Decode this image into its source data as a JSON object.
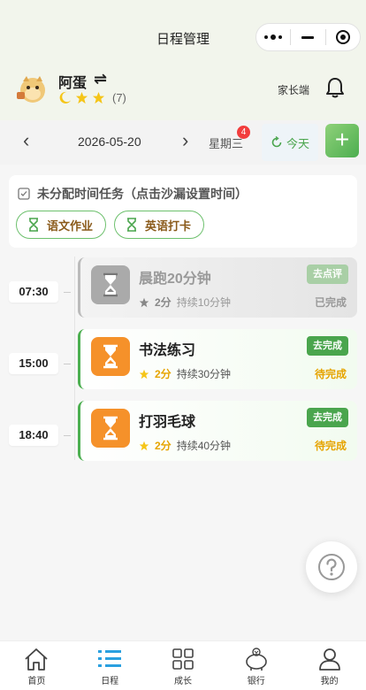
{
  "nav": {
    "title": "日程管理"
  },
  "profile": {
    "name": "阿蛋",
    "switch_icon": "⇌",
    "star_count": "(7)",
    "parent_link": "家长端"
  },
  "datebar": {
    "date": "2026-05-20",
    "weekday": "星期三",
    "badge": "4",
    "today": "今天",
    "add": "+"
  },
  "unassigned": {
    "title": "未分配时间任务（点击沙漏设置时间）",
    "chips": [
      {
        "label": "语文作业"
      },
      {
        "label": "英语打卡"
      }
    ]
  },
  "schedule": [
    {
      "time": "07:30",
      "title": "晨跑20分钟",
      "points": "2分",
      "duration": "持续10分钟",
      "action": "去点评",
      "status": "已完成"
    },
    {
      "time": "15:00",
      "title": "书法练习",
      "points": "2分",
      "duration": "持续30分钟",
      "action": "去完成",
      "status": "待完成"
    },
    {
      "time": "18:40",
      "title": "打羽毛球",
      "points": "2分",
      "duration": "持续40分钟",
      "action": "去完成",
      "status": "待完成"
    }
  ],
  "tabs": [
    {
      "label": "首页",
      "icon": "home-icon"
    },
    {
      "label": "日程",
      "icon": "list-icon"
    },
    {
      "label": "成长",
      "icon": "grid-icon"
    },
    {
      "label": "银行",
      "icon": "piggy-bank-icon"
    },
    {
      "label": "我的",
      "icon": "user-icon"
    }
  ],
  "colors": {
    "accent": "#4aa54d",
    "orange": "#f5912a",
    "gold": "#e6a400",
    "badge": "#f23d3d"
  }
}
